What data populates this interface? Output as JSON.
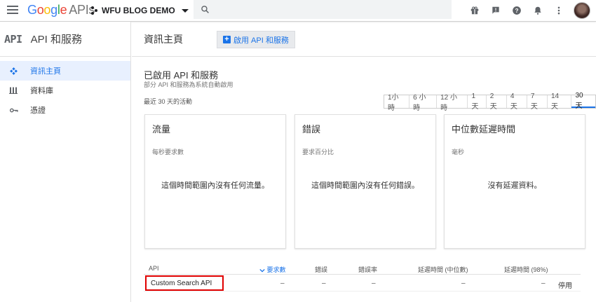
{
  "topbar": {
    "logo_parts": [
      "G",
      "o",
      "o",
      "g",
      "l",
      "e"
    ],
    "logo_apis": "APIs",
    "project_name": "WFU BLOG DEMO",
    "search_placeholder": ""
  },
  "sidebar": {
    "brand_mark": "API",
    "title": "API 和服務",
    "items": [
      {
        "label": "資訊主頁",
        "icon": "dashboard-icon",
        "active": true
      },
      {
        "label": "資料庫",
        "icon": "library-icon",
        "active": false
      },
      {
        "label": "憑證",
        "icon": "key-icon",
        "active": false
      }
    ]
  },
  "main": {
    "page_title": "資訊主頁",
    "enable_button": "啟用 API 和服務",
    "section_title": "已啟用 API 和服務",
    "section_subtitle": "部分 API 和服務為系統自動啟用",
    "recent_label": "最近 30 天的活動",
    "ranges": [
      "1小時",
      "6 小時",
      "12 小時",
      "1天",
      "2 天",
      "4 天",
      "7 天",
      "14 天",
      "30 天"
    ],
    "selected_range": "30 天",
    "cards": [
      {
        "title": "流量",
        "unit": "每秒要求數",
        "empty": "這個時間範圍內沒有任何流量。"
      },
      {
        "title": "錯誤",
        "unit": "要求百分比",
        "empty": "這個時間範圍內沒有任何錯誤。"
      },
      {
        "title": "中位數延遲時間",
        "unit": "毫秒",
        "empty": "沒有延遲資料。"
      }
    ],
    "table": {
      "headers": {
        "api": "API",
        "requests": "要求數",
        "errors": "錯誤",
        "error_rate": "錯誤率",
        "latency_median": "延遲時間 (中位數)",
        "latency_98": "延遲時間 (98%)"
      },
      "rows": [
        {
          "api": "Custom Search API",
          "requests": "–",
          "errors": "–",
          "error_rate": "–",
          "latency_median": "–",
          "latency_98": "–",
          "action": "停用"
        }
      ]
    }
  },
  "colors": {
    "accent": "#1a73e8",
    "highlight_border": "#e00000",
    "active_bg": "#e8f0fe"
  }
}
